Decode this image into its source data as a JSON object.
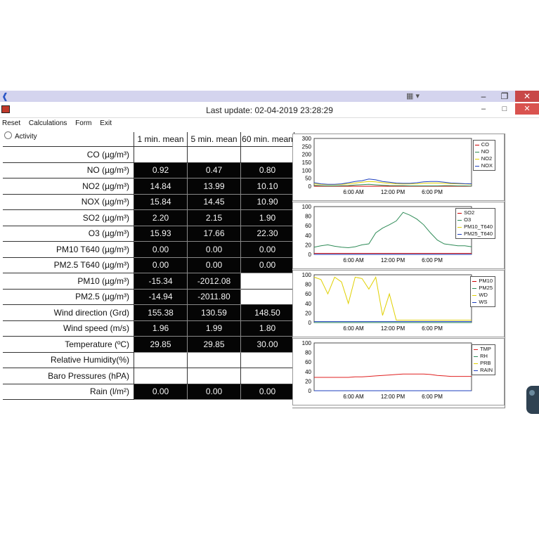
{
  "window": {
    "title": "Last update: 02-04-2019 23:28:29",
    "app_icon": "edge-like-icon",
    "top_controls": [
      "minimize-icon",
      "restore-icon",
      "close-icon"
    ],
    "form_controls": [
      "minimize-icon",
      "maximize-icon",
      "close-icon"
    ]
  },
  "menu": [
    "Reset",
    "Calculations",
    "Form",
    "Exit"
  ],
  "activity_label": "Activity",
  "table": {
    "columns": [
      "1 min. mean",
      "5 min. mean",
      "60 min. mean"
    ],
    "rows": [
      {
        "label": "CO (µg/m³)",
        "values": [
          "",
          "",
          ""
        ],
        "filled": false
      },
      {
        "label": "NO (µg/m³)",
        "values": [
          "0.92",
          "0.47",
          "0.80"
        ],
        "filled": true
      },
      {
        "label": "NO2 (µg/m³)",
        "values": [
          "14.84",
          "13.99",
          "10.10"
        ],
        "filled": true
      },
      {
        "label": "NOX (µg/m³)",
        "values": [
          "15.84",
          "14.45",
          "10.90"
        ],
        "filled": true
      },
      {
        "label": "SO2 (µg/m³)",
        "values": [
          "2.20",
          "2.15",
          "1.90"
        ],
        "filled": true
      },
      {
        "label": "O3 (µg/m³)",
        "values": [
          "15.93",
          "17.66",
          "22.30"
        ],
        "filled": true
      },
      {
        "label": "PM10 T640 (µg/m³)",
        "values": [
          "0.00",
          "0.00",
          "0.00"
        ],
        "filled": true
      },
      {
        "label": "PM2.5 T640 (µg/m³)",
        "values": [
          "0.00",
          "0.00",
          "0.00"
        ],
        "filled": true
      },
      {
        "label": "PM10 (µg/m³)",
        "values": [
          "-15.34",
          "-2012.08",
          ""
        ],
        "filled": "partial"
      },
      {
        "label": "PM2.5 (µg/m³)",
        "values": [
          "-14.94",
          "-2011.80",
          ""
        ],
        "filled": "partial"
      },
      {
        "label": "Wind direction (Grd)",
        "values": [
          "155.38",
          "130.59",
          "148.50"
        ],
        "filled": true
      },
      {
        "label": "Wind speed (m/s)",
        "values": [
          "1.96",
          "1.99",
          "1.80"
        ],
        "filled": true
      },
      {
        "label": "Temperature (ºC)",
        "values": [
          "29.85",
          "29.85",
          "30.00"
        ],
        "filled": true
      },
      {
        "label": "Relative Humidity(%)",
        "values": [
          "",
          "",
          ""
        ],
        "filled": false
      },
      {
        "label": "Baro Pressures (hPA)",
        "values": [
          "",
          "",
          ""
        ],
        "filled": false
      },
      {
        "label": "Rain (l/m²)",
        "values": [
          "0.00",
          "0.00",
          "0.00"
        ],
        "filled": true
      }
    ]
  },
  "chart_data": [
    {
      "type": "line",
      "title": "",
      "ylim": [
        0,
        300
      ],
      "yticks": [
        "300",
        "250",
        "200",
        "150",
        "100",
        "50",
        "0"
      ],
      "xticks": [
        "6:00 AM",
        "12:00 PM",
        "6:00 PM"
      ],
      "series": [
        {
          "name": "CO",
          "color": "#cc0000",
          "values": [
            0,
            0,
            0,
            0,
            0,
            0,
            0,
            0,
            0,
            0,
            0,
            0,
            0,
            0,
            0,
            0,
            0,
            0,
            0,
            0,
            0,
            0,
            0,
            0
          ]
        },
        {
          "name": "NO",
          "color": "#2e8b57",
          "values": [
            5,
            3,
            2,
            2,
            3,
            4,
            8,
            10,
            12,
            9,
            6,
            4,
            3,
            3,
            2,
            2,
            2,
            2,
            2,
            3,
            3,
            2,
            2,
            1
          ]
        },
        {
          "name": "NO2",
          "color": "#e0d000",
          "values": [
            15,
            12,
            10,
            10,
            12,
            15,
            20,
            25,
            30,
            28,
            22,
            18,
            15,
            14,
            14,
            15,
            18,
            20,
            20,
            18,
            16,
            15,
            14,
            13
          ]
        },
        {
          "name": "NOX",
          "color": "#1e3fbf",
          "values": [
            22,
            15,
            12,
            12,
            15,
            22,
            30,
            35,
            45,
            40,
            30,
            25,
            20,
            18,
            18,
            22,
            28,
            30,
            30,
            25,
            20,
            18,
            16,
            15
          ]
        }
      ],
      "legend_position": "right"
    },
    {
      "type": "line",
      "title": "",
      "ylim": [
        0,
        100
      ],
      "yticks": [
        "100",
        "80",
        "60",
        "40",
        "20",
        "0"
      ],
      "xticks": [
        "6:00 AM",
        "12:00 PM",
        "6:00 PM"
      ],
      "series": [
        {
          "name": "SO2",
          "color": "#cc0000",
          "values": [
            2,
            2,
            2,
            2,
            2,
            2,
            2,
            2,
            2,
            2,
            2,
            2,
            2,
            2,
            2,
            2,
            2,
            2,
            2,
            2,
            2,
            2,
            2,
            2
          ]
        },
        {
          "name": "O3",
          "color": "#2e8b57",
          "values": [
            15,
            18,
            20,
            17,
            15,
            14,
            16,
            20,
            22,
            45,
            55,
            62,
            70,
            88,
            82,
            74,
            62,
            45,
            30,
            22,
            20,
            18,
            18,
            16
          ]
        },
        {
          "name": "PM10_T640",
          "color": "#e0d000",
          "values": [
            0,
            0,
            0,
            0,
            0,
            0,
            0,
            0,
            0,
            0,
            0,
            0,
            0,
            0,
            0,
            0,
            0,
            0,
            0,
            0,
            0,
            0,
            0,
            0
          ]
        },
        {
          "name": "PM25_T640",
          "color": "#1e3fbf",
          "values": [
            0,
            0,
            0,
            0,
            0,
            0,
            0,
            0,
            0,
            0,
            0,
            0,
            0,
            0,
            0,
            0,
            0,
            0,
            0,
            0,
            0,
            0,
            0,
            0
          ]
        }
      ],
      "legend_position": "right"
    },
    {
      "type": "line",
      "title": "",
      "ylim": [
        0,
        100
      ],
      "yticks": [
        "100",
        "80",
        "60",
        "40",
        "20",
        "0"
      ],
      "xticks": [
        "6:00 AM",
        "12:00 PM",
        "6:00 PM"
      ],
      "series": [
        {
          "name": "PM10",
          "color": "#cc0000",
          "values": [
            0,
            0,
            0,
            0,
            0,
            0,
            0,
            0,
            0,
            0,
            0,
            0,
            0,
            0,
            0,
            0,
            0,
            0,
            0,
            0,
            0,
            0,
            0,
            0
          ]
        },
        {
          "name": "PM25",
          "color": "#2e8b57",
          "values": [
            0,
            0,
            0,
            0,
            0,
            0,
            0,
            0,
            0,
            0,
            0,
            0,
            0,
            0,
            0,
            0,
            0,
            0,
            0,
            0,
            0,
            0,
            0,
            0
          ]
        },
        {
          "name": "WD",
          "color": "#e0d000",
          "values": [
            95,
            90,
            60,
            95,
            85,
            40,
            95,
            92,
            70,
            95,
            15,
            60,
            5,
            5,
            5,
            5,
            5,
            5,
            5,
            5,
            5,
            5,
            5,
            5
          ]
        },
        {
          "name": "WS",
          "color": "#1e3fbf",
          "values": [
            2,
            2,
            2,
            2,
            2,
            2,
            2,
            2,
            2,
            2,
            2,
            2,
            2,
            2,
            2,
            2,
            2,
            2,
            2,
            2,
            2,
            2,
            2,
            2
          ]
        }
      ],
      "legend_position": "right"
    },
    {
      "type": "line",
      "title": "",
      "ylim": [
        0,
        100
      ],
      "yticks": [
        "100",
        "80",
        "60",
        "40",
        "20",
        "0"
      ],
      "xticks": [
        "6:00 AM",
        "12:00 PM",
        "6:00 PM"
      ],
      "series": [
        {
          "name": "TMP",
          "color": "#e02020",
          "values": [
            28,
            28,
            28,
            28,
            28,
            28,
            29,
            29,
            30,
            31,
            32,
            33,
            34,
            35,
            35,
            35,
            35,
            34,
            32,
            31,
            30,
            30,
            30,
            30
          ]
        },
        {
          "name": "RH",
          "color": "#2e8b57",
          "values": [
            0,
            0,
            0,
            0,
            0,
            0,
            0,
            0,
            0,
            0,
            0,
            0,
            0,
            0,
            0,
            0,
            0,
            0,
            0,
            0,
            0,
            0,
            0,
            0
          ]
        },
        {
          "name": "PRB",
          "color": "#e0d000",
          "values": [
            0,
            0,
            0,
            0,
            0,
            0,
            0,
            0,
            0,
            0,
            0,
            0,
            0,
            0,
            0,
            0,
            0,
            0,
            0,
            0,
            0,
            0,
            0,
            0
          ]
        },
        {
          "name": "RAIN",
          "color": "#1e3fbf",
          "values": [
            0,
            0,
            0,
            0,
            0,
            0,
            0,
            0,
            0,
            0,
            0,
            0,
            0,
            0,
            0,
            0,
            0,
            0,
            0,
            0,
            0,
            0,
            0,
            0
          ]
        }
      ],
      "legend_position": "right"
    }
  ]
}
